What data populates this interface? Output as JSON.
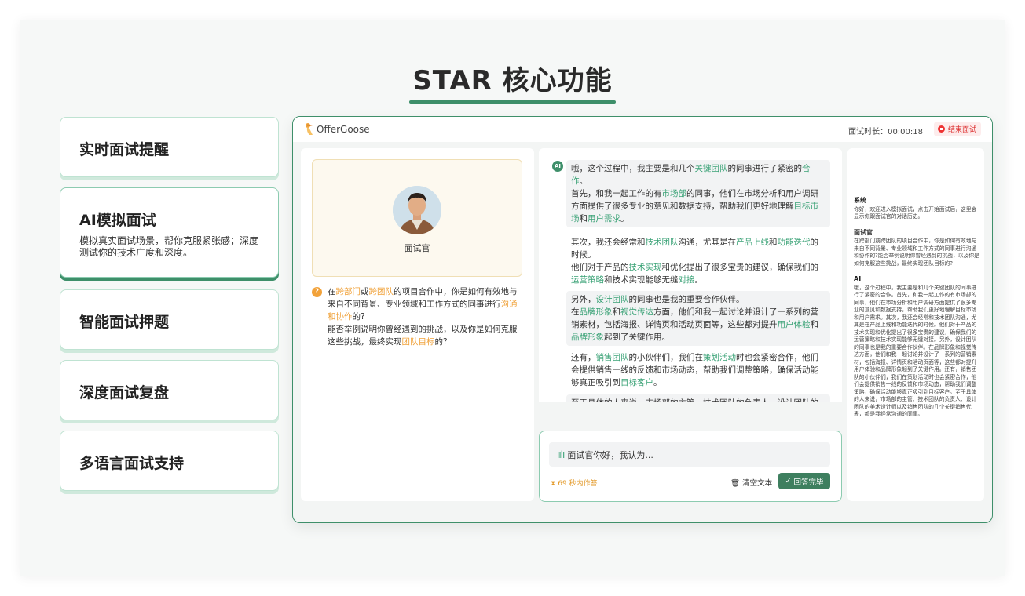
{
  "page": {
    "title": "STAR 核心功能"
  },
  "features": [
    {
      "label": "实时面试提醒"
    },
    {
      "label": "AI模拟面试",
      "description": "模拟真实面试场景，帮你克服紧张感；深度测试你的技术广度和深度。"
    },
    {
      "label": "智能面试押题"
    },
    {
      "label": "深度面试复盘"
    },
    {
      "label": "多语言面试支持"
    }
  ],
  "app": {
    "brand": "OfferGoose",
    "timer_label": "面试时长：00:00:18",
    "end_button": "结束面试",
    "interviewer_label": "面试官",
    "question": {
      "icon": "?",
      "segments": [
        {
          "text": "在",
          "hl": false
        },
        {
          "text": "跨部门",
          "hl": true
        },
        {
          "text": "或",
          "hl": false
        },
        {
          "text": "跨团队",
          "hl": true
        },
        {
          "text": "的项目合作中，你是如何有效地与来自不同背景、专业领域和工作方式的同事进行",
          "hl": false
        },
        {
          "text": "沟通和协作",
          "hl": true
        },
        {
          "text": "的?",
          "hl": false
        },
        {
          "text": "能否举例说明你曾经遇到的挑战，以及你是如何克服这些挑战，最终实现",
          "hl": false
        },
        {
          "text": "团队目标",
          "hl": true
        },
        {
          "text": "的?",
          "hl": false
        }
      ]
    },
    "ai_badge": "AI",
    "answer_blocks": [
      [
        {
          "t": "哦，这个过程中，我主要是和几个"
        },
        {
          "t": "关键团队",
          "h": 1
        },
        {
          "t": "的同事进行了紧密的"
        },
        {
          "t": "合作",
          "h": 1
        },
        {
          "t": "。"
        },
        {
          "br": 1
        },
        {
          "t": "首先，和我一起工作的有"
        },
        {
          "t": "市场部",
          "h": 1
        },
        {
          "t": "的同事，他们在市场分析和用户调研方面提供了很多专业的意见和数据支持，帮助我们更好地理解"
        },
        {
          "t": "目标市场",
          "h": 1
        },
        {
          "t": "和"
        },
        {
          "t": "用户需求",
          "h": 1
        },
        {
          "t": "。"
        }
      ],
      [
        {
          "t": "其次，我还会经常和"
        },
        {
          "t": "技术团队",
          "h": 1
        },
        {
          "t": "沟通，尤其是在"
        },
        {
          "t": "产品上线",
          "h": 1
        },
        {
          "t": "和"
        },
        {
          "t": "功能迭代",
          "h": 1
        },
        {
          "t": "的时候。"
        },
        {
          "br": 1
        },
        {
          "t": "他们对于产品的"
        },
        {
          "t": "技术实现",
          "h": 1
        },
        {
          "t": "和优化提出了很多宝贵的建议，确保我们的"
        },
        {
          "t": "运营策略",
          "h": 1
        },
        {
          "t": "和技术实现能够无缝"
        },
        {
          "t": "对接",
          "h": 1
        },
        {
          "t": "。"
        }
      ],
      [
        {
          "t": "另外，"
        },
        {
          "t": "设计团队",
          "h": 1
        },
        {
          "t": "的同事也是我的重要合作伙伴。"
        },
        {
          "br": 1
        },
        {
          "t": "在"
        },
        {
          "t": "品牌形象",
          "h": 1
        },
        {
          "t": "和"
        },
        {
          "t": "视觉传达",
          "h": 1
        },
        {
          "t": "方面，他们和我一起讨论并设计了一系列的营销素材，包括海报、详情页和活动页面等，这些都对提升"
        },
        {
          "t": "用户体验",
          "h": 1
        },
        {
          "t": "和"
        },
        {
          "t": "品牌形象",
          "h": 1
        },
        {
          "t": "起到了关键作用。"
        }
      ],
      [
        {
          "t": "还有，"
        },
        {
          "t": "销售团队",
          "h": 1
        },
        {
          "t": "的小伙伴们，我们在"
        },
        {
          "t": "策划活动",
          "h": 1
        },
        {
          "t": "时也会紧密合作，他们会提供销售一线的反馈和市场动态，帮助我们调整策略，确保活动能够真正吸引到"
        },
        {
          "t": "目标客户",
          "h": 1
        },
        {
          "t": "。"
        }
      ],
      [
        {
          "t": "至于具体的人来说，市场部的主管、技术团队的负责人、设计团队的"
        },
        {
          "t": "美术设计师",
          "h": 1
        },
        {
          "t": "以及销售团队的几个关键"
        },
        {
          "t": "销售代表",
          "h": 1
        },
        {
          "t": "，都是我经常沟通的同事。"
        }
      ]
    ],
    "input_text": "面试官你好，我认为...",
    "countdown": "69 秒内作答",
    "clear_button": "清空文本",
    "submit_button": "回答完毕",
    "log": [
      {
        "who": "系统",
        "text": "你好，欢迎进入模拟面试，点击开始面试后，这里会显示你跟面试官的对话历史。"
      },
      {
        "who": "面试官",
        "text": "在跨部门或跨团队的项目合作中，你是如何有效地与来自不同背景、专业领域和工作方式的同事进行沟通和协作的?能否举例说明你曾经遇到的挑战，以及你是如何克服这些挑战，最终实现团队目标的?"
      },
      {
        "who": "AI",
        "text": "哦，这个过程中，我主要是和几个关键团队的同事进行了紧密的合作。首先，和我一起工作的有市场部的同事，他们在市场分析和用户调研方面提供了很多专业的意见和数据支持，帮助我们更好地理解目标市场和用户需求。其次，我还会经常和技术团队沟通，尤其是在产品上线和功能迭代的时候。他们对于产品的技术实现和优化提出了很多宝贵的建议，确保我们的运营策略和技术实现能够无缝对接。另外，设计团队的同事也是我的重要合作伙伴。在品牌形象和视觉传达方面，他们和我一起讨论并设计了一系列的营销素材，包括海报、详情页和活动页面等，这些都对提升用户体验和品牌形象起到了关键作用。还有，销售团队的小伙伴们，我们在策划活动时也会紧密合作，他们会提供销售一线的反馈和市场动态，帮助我们调整策略，确保活动能够真正吸引到目标客户。至于具体的人来说，市场部的主管、技术团队的负责人、设计团队的美术设计师以及销售团队的几个关键销售代表，都是我经常沟通的同事。"
      }
    ]
  }
}
